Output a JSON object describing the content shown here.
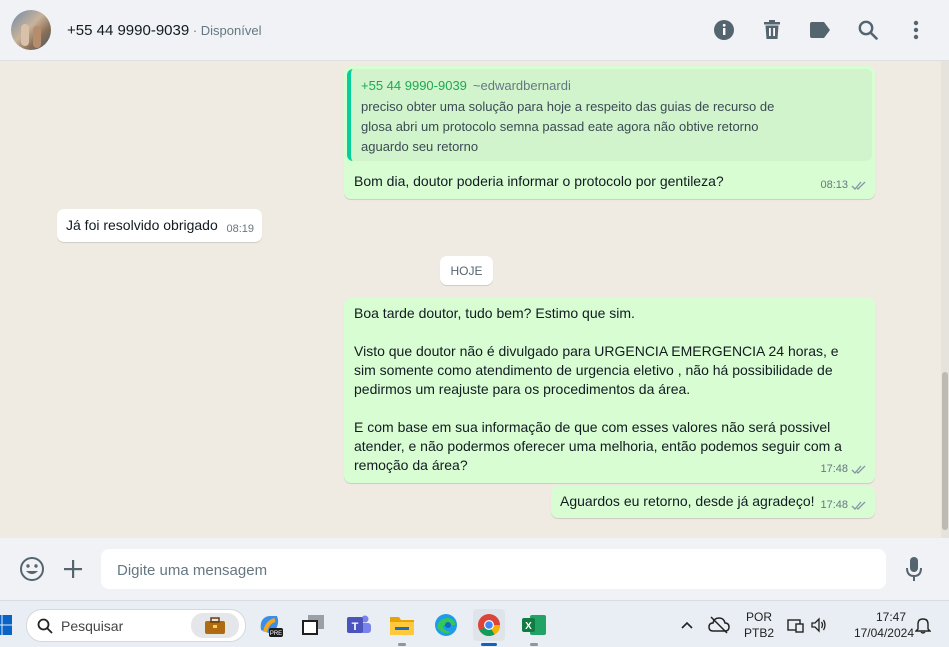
{
  "header": {
    "contact_name": "+55 44 9990-9039",
    "status": " · Disponível",
    "icons": [
      "info-icon",
      "trash-icon",
      "label-icon",
      "search-icon",
      "more-icon"
    ]
  },
  "messages": {
    "quoted": {
      "number": "+55 44 9990-9039",
      "name": "~edwardbernardi",
      "text": "preciso obter uma solução para hoje a respeito das guias de recurso de glosa abri um protocolo semna passad eate agora não obtive retorno aguardo seu retorno"
    },
    "m1": {
      "text": "Bom dia, doutor poderia informar o protocolo por gentileza?",
      "time": "08:13"
    },
    "m2": {
      "text": "Já foi resolvido obrigado",
      "time": "08:19"
    },
    "day": "HOJE",
    "m3": {
      "p1": "Boa tarde doutor, tudo bem? Estimo que sim.",
      "p2": "Visto que doutor não é divulgado para URGENCIA EMERGENCIA 24 horas, e sim somente como atendimento de urgencia eletivo , não há possibilidade de pedirmos um reajuste para os procedimentos da área.",
      "p3": "E com base em sua informação de que com esses valores não será possivel atender, e não podermos oferecer uma melhoria, então podemos seguir com a remoção da área?",
      "time": "17:48"
    },
    "m4": {
      "text": "Aguardos eu retorno, desde já agradeço!",
      "time": "17:48"
    }
  },
  "compose": {
    "placeholder": "Digite uma mensagem"
  },
  "taskbar": {
    "search_placeholder": "Pesquisar",
    "lang_line1": "POR",
    "lang_line2": "PTB2",
    "time": "17:47",
    "date": "17/04/2024"
  },
  "colors": {
    "outgoing_bubble": "#d9fdd3",
    "incoming_bubble": "#ffffff",
    "quote_accent": "#06cf9c",
    "chat_bg": "#efeae2"
  }
}
